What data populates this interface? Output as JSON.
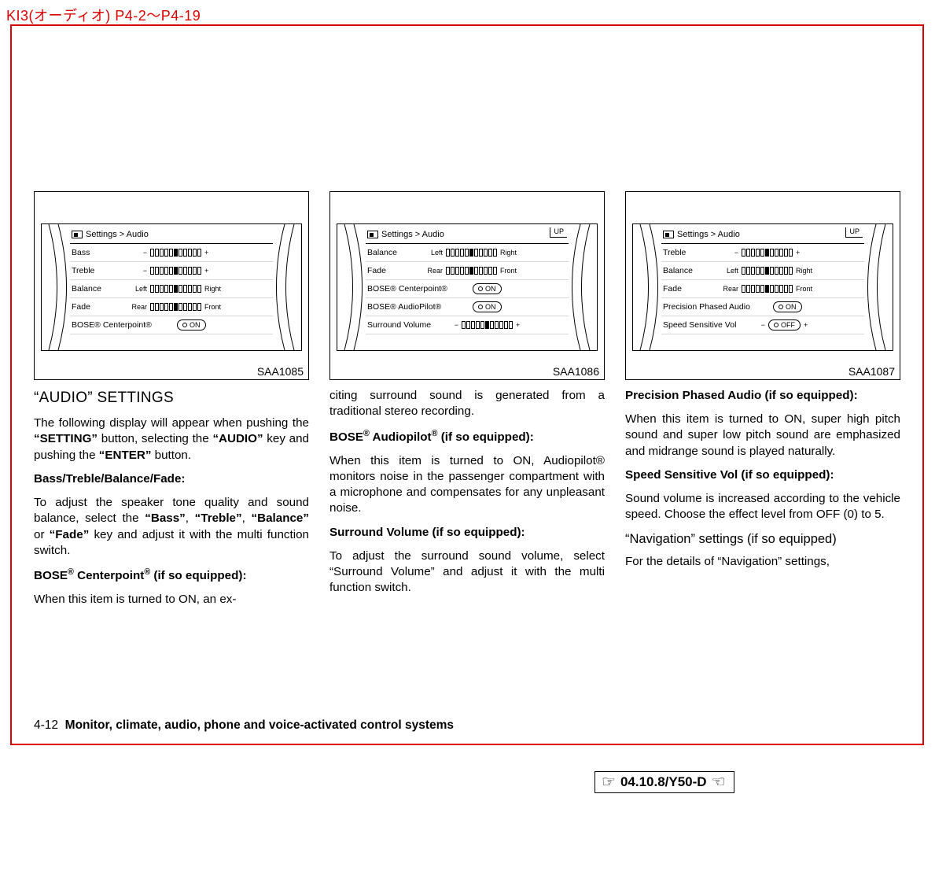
{
  "header": {
    "top_label": "KI3(オーディオ) P4-2～P4-19"
  },
  "screens": {
    "s1": {
      "breadcrumb": "Settings > Audio",
      "rows": {
        "r1": {
          "name": "Bass",
          "left": "−",
          "right": "+"
        },
        "r2": {
          "name": "Treble",
          "left": "−",
          "right": "+"
        },
        "r3": {
          "name": "Balance",
          "left": "Left",
          "right": "Right"
        },
        "r4": {
          "name": "Fade",
          "left": "Rear",
          "right": "Front"
        },
        "r5": {
          "name": "BOSE® Centerpoint®",
          "state": "ON"
        }
      },
      "label": "SAA1085"
    },
    "s2": {
      "breadcrumb": "Settings > Audio",
      "up": "UP",
      "rows": {
        "r1": {
          "name": "Balance",
          "left": "Left",
          "right": "Right"
        },
        "r2": {
          "name": "Fade",
          "left": "Rear",
          "right": "Front"
        },
        "r3": {
          "name": "BOSE® Centerpoint®",
          "state": "ON"
        },
        "r4": {
          "name": "BOSE® AudioPilot®",
          "state": "ON"
        },
        "r5": {
          "name": "Surround Volume",
          "left": "−",
          "right": "+"
        }
      },
      "label": "SAA1086"
    },
    "s3": {
      "breadcrumb": "Settings > Audio",
      "up": "UP",
      "rows": {
        "r1": {
          "name": "Treble",
          "left": "−",
          "right": "+"
        },
        "r2": {
          "name": "Balance",
          "left": "Left",
          "right": "Right"
        },
        "r3": {
          "name": "Fade",
          "left": "Rear",
          "right": "Front"
        },
        "r4": {
          "name": "Precision Phased Audio",
          "state": "ON"
        },
        "r5": {
          "name": "Speed Sensitive Vol",
          "left": "−",
          "state": "OFF",
          "right": "+"
        }
      },
      "label": "SAA1087"
    }
  },
  "col1": {
    "h2": "“AUDIO” SETTINGS",
    "p1a": "The following display will appear when pushing the ",
    "p1b": "“SETTING”",
    "p1c": " button, selecting the ",
    "p1d": "“AUDIO”",
    "p1e": " key and pushing the ",
    "p1f": "“EN­TER”",
    "p1g": " button.",
    "p2": "Bass/Treble/Balance/Fade:",
    "p3a": "To adjust the speaker tone quality and sound balance, select the ",
    "p3b": "“Bass”",
    "p3c": ", ",
    "p3d": "“Treble”",
    "p3e": ", ",
    "p3f": "“Balance”",
    "p3g": " or ",
    "p3h": "“Fade”",
    "p3i": " key and ad­just it with the multi function switch.",
    "p4a": "BOSE",
    "p4b": " Centerpoint",
    "p4c": " (if so equipped):",
    "p5": "When this item is turned to ON, an ex-"
  },
  "col2": {
    "p1": "citing surround sound is generated from a traditional stereo recording.",
    "p2a": "BOSE",
    "p2b": " Audiopilot",
    "p2c": " (if so equipped):",
    "p3": "When this item is turned to ON, Audiopilot® monitors noise in the passen­ger compartment with a microphone and compensates for any unpleasant noise.",
    "p4": "Surround Volume (if so equipped):",
    "p5": "To adjust the surround sound volume, se­lect “Surround Volume” and adjust it with the multi function switch."
  },
  "col3": {
    "p1": "Precision Phased Audio (if so equipped):",
    "p2": "When this item is turned to ON, super high pitch sound and super low pitch sound are emphasized and midrange sound is played naturally.",
    "p3": "Speed Sensitive Vol (if so equipped):",
    "p4": "Sound volume is increased according to the vehicle speed. Choose the effect level from OFF (0) to 5.",
    "h3": "“Navigation” settings (if so equipped)",
    "p5": "For the details of “Navigation” settings,"
  },
  "footer": {
    "pnum": "4-12",
    "ptxt": "Monitor, climate, audio, phone and voice-activated control systems"
  },
  "datebox": {
    "text": "04.10.8/Y50-D"
  }
}
